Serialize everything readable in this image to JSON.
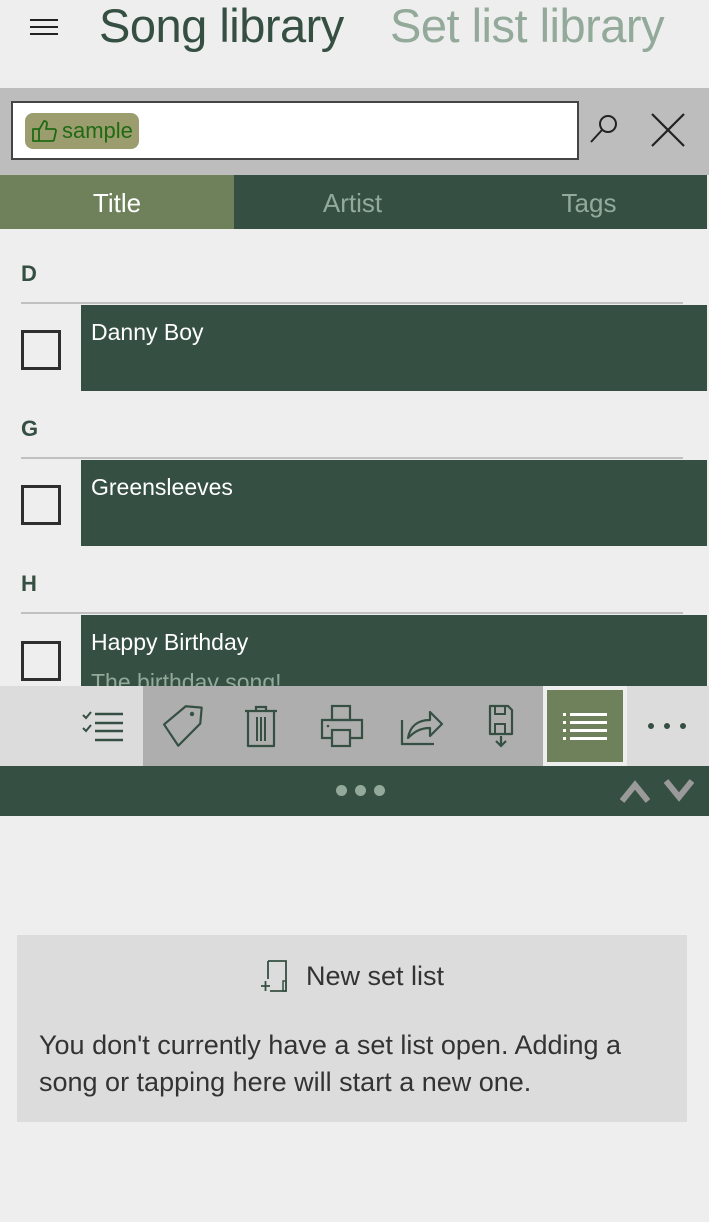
{
  "header": {
    "menu_icon": "hamburger-icon",
    "pivots": [
      {
        "label": "Song library",
        "active": true
      },
      {
        "label": "Set list library",
        "active": false
      }
    ]
  },
  "search": {
    "tag_filter": {
      "icon": "thumbs-up-icon",
      "label": "sample"
    },
    "value": "",
    "search_icon": "search-icon",
    "clear_icon": "close-icon"
  },
  "tabs": [
    {
      "label": "Title",
      "active": true
    },
    {
      "label": "Artist",
      "active": false
    },
    {
      "label": "Tags",
      "active": false
    }
  ],
  "song_groups": [
    {
      "letter": "D",
      "songs": [
        {
          "title": "Danny Boy",
          "subtitle": "",
          "checked": false
        }
      ]
    },
    {
      "letter": "G",
      "songs": [
        {
          "title": "Greensleeves",
          "subtitle": "",
          "checked": false
        }
      ]
    },
    {
      "letter": "H",
      "songs": [
        {
          "title": "Happy Birthday",
          "subtitle": "The birthday song!",
          "checked": false
        }
      ]
    }
  ],
  "toolbar": {
    "buttons": [
      {
        "name": "select-items",
        "icon": "checklist-icon"
      },
      {
        "name": "tag",
        "icon": "tag-icon"
      },
      {
        "name": "delete",
        "icon": "trash-icon"
      },
      {
        "name": "print",
        "icon": "printer-icon"
      },
      {
        "name": "share",
        "icon": "share-icon"
      },
      {
        "name": "save",
        "icon": "save-icon"
      },
      {
        "name": "list-view",
        "icon": "list-icon",
        "active": true
      },
      {
        "name": "more",
        "icon": "more-icon"
      }
    ]
  },
  "splitter": {
    "handle_icon": "drag-handle-icon",
    "up_icon": "chevron-up-icon",
    "down_icon": "chevron-down-icon"
  },
  "setlist_panel": {
    "new_setlist_label": "New set list",
    "message": "You don't currently have a set list open. Adding a song or tapping here will start a new one."
  },
  "colors": {
    "primary": "#355043",
    "accent": "#6f815a",
    "muted": "#93aa9b",
    "tag_chip": "#9c9d6e",
    "background": "#eeeeee"
  }
}
